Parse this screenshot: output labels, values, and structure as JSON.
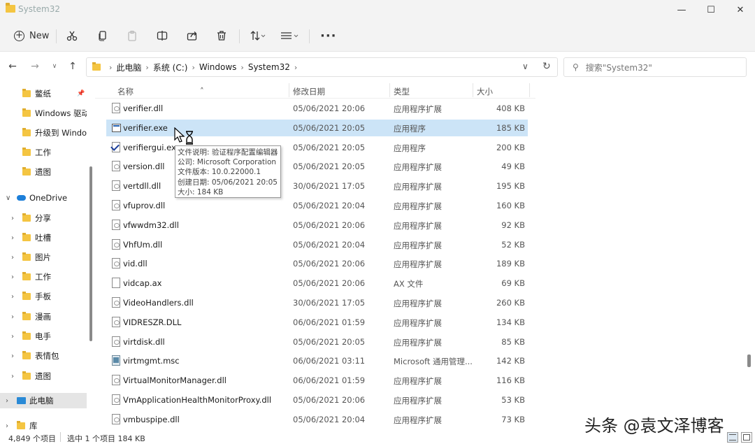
{
  "window": {
    "title": "System32"
  },
  "toolbar": {
    "new_label": "New"
  },
  "address": {
    "crumbs": [
      "此电脑",
      "系统 (C:)",
      "Windows",
      "System32"
    ],
    "search_placeholder": "搜索\"System32\""
  },
  "sidebar": {
    "quick_items": [
      "鳖纸",
      "Windows 驱动",
      "升级到 Window",
      "工作",
      "遗图"
    ],
    "onedrive": "OneDrive",
    "onedrive_items": [
      "分享",
      "吐槽",
      "图片",
      "工作",
      "手板",
      "漫画",
      "电手",
      "表情包",
      "遗图"
    ],
    "this_pc": "此电脑",
    "library": "库"
  },
  "columns": {
    "name": "名称",
    "date": "修改日期",
    "type": "类型",
    "size": "大小"
  },
  "files": [
    {
      "name": "verifier.dll",
      "date": "05/06/2021 20:06",
      "type": "应用程序扩展",
      "size": "408 KB",
      "icon": "dll"
    },
    {
      "name": "verifier.exe",
      "date": "05/06/2021 20:05",
      "type": "应用程序",
      "size": "185 KB",
      "icon": "exe",
      "selected": true
    },
    {
      "name": "verifiergui.exe",
      "date": "05/06/2021 20:05",
      "type": "应用程序",
      "size": "200 KB",
      "icon": "check"
    },
    {
      "name": "version.dll",
      "date": "05/06/2021 20:05",
      "type": "应用程序扩展",
      "size": "49 KB",
      "icon": "dll"
    },
    {
      "name": "vertdll.dll",
      "date": "30/06/2021 17:05",
      "type": "应用程序扩展",
      "size": "195 KB",
      "icon": "dll"
    },
    {
      "name": "vfuprov.dll",
      "date": "05/06/2021 20:04",
      "type": "应用程序扩展",
      "size": "160 KB",
      "icon": "dll"
    },
    {
      "name": "vfwwdm32.dll",
      "date": "05/06/2021 20:06",
      "type": "应用程序扩展",
      "size": "92 KB",
      "icon": "dll"
    },
    {
      "name": "VhfUm.dll",
      "date": "05/06/2021 20:04",
      "type": "应用程序扩展",
      "size": "52 KB",
      "icon": "dll"
    },
    {
      "name": "vid.dll",
      "date": "05/06/2021 20:06",
      "type": "应用程序扩展",
      "size": "189 KB",
      "icon": "dll"
    },
    {
      "name": "vidcap.ax",
      "date": "05/06/2021 20:06",
      "type": "AX 文件",
      "size": "69 KB",
      "icon": "plain"
    },
    {
      "name": "VideoHandlers.dll",
      "date": "30/06/2021 17:05",
      "type": "应用程序扩展",
      "size": "260 KB",
      "icon": "dll"
    },
    {
      "name": "VIDRESZR.DLL",
      "date": "06/06/2021 01:59",
      "type": "应用程序扩展",
      "size": "134 KB",
      "icon": "dll"
    },
    {
      "name": "virtdisk.dll",
      "date": "05/06/2021 20:05",
      "type": "应用程序扩展",
      "size": "85 KB",
      "icon": "dll"
    },
    {
      "name": "virtmgmt.msc",
      "date": "06/06/2021 03:11",
      "type": "Microsoft 通用管理...",
      "size": "142 KB",
      "icon": "msc"
    },
    {
      "name": "VirtualMonitorManager.dll",
      "date": "06/06/2021 01:59",
      "type": "应用程序扩展",
      "size": "116 KB",
      "icon": "dll"
    },
    {
      "name": "VmApplicationHealthMonitorProxy.dll",
      "date": "05/06/2021 20:06",
      "type": "应用程序扩展",
      "size": "53 KB",
      "icon": "dll"
    },
    {
      "name": "vmbuspipe.dll",
      "date": "05/06/2021 20:04",
      "type": "应用程序扩展",
      "size": "73 KB",
      "icon": "dll"
    }
  ],
  "tooltip": {
    "lines": [
      "文件说明: 验证程序配置编辑器",
      "公司: Microsoft Corporation",
      "文件版本: 10.0.22000.1",
      "创建日期: 05/06/2021 20:05",
      "大小: 184 KB"
    ]
  },
  "status": {
    "count": "4,849 个项目",
    "selection": "选中 1 个项目  184 KB"
  },
  "watermark": "头条 @袁文泽博客"
}
